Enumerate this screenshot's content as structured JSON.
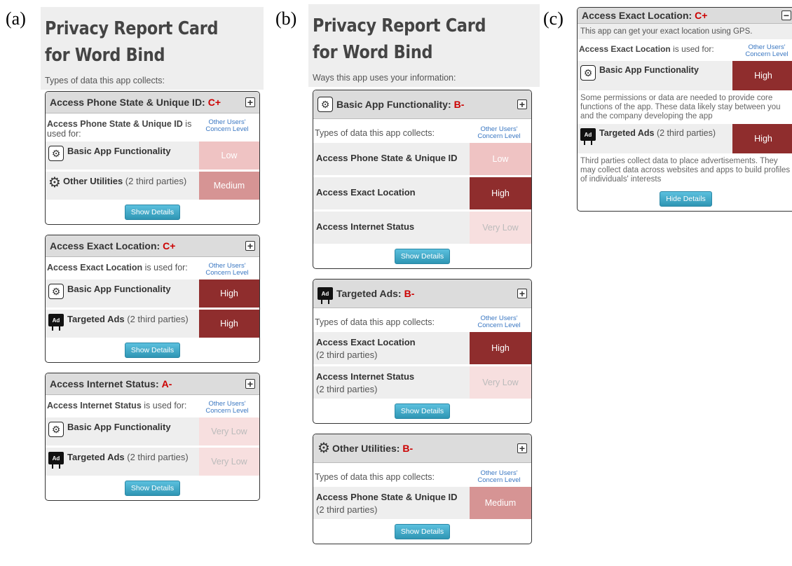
{
  "figure_labels": [
    "(a)",
    "(b)",
    "(c)"
  ],
  "panel_a": {
    "title": "Privacy Report Card for Word Bind",
    "subtitle": "Types of data this app collects:",
    "cards": [
      {
        "name": "Access Phone State & Unique ID:",
        "grade": "C+",
        "toggle": "+",
        "used_bold": "Access Phone State & Unique ID",
        "used_rest": " is used for:",
        "concern": "Other Users' Concern Level",
        "rows": [
          {
            "icon": "gear-icon",
            "label": "Basic App Functionality",
            "extra": "",
            "level": "Low"
          },
          {
            "icon": "gears-icon",
            "label": "Other Utilities",
            "extra": " (2 third parties)",
            "level": "Medium"
          }
        ],
        "button": "Show Details"
      },
      {
        "name": "Access Exact Location:",
        "grade": "C+",
        "toggle": "+",
        "used_bold": "Access Exact Location",
        "used_rest": " is used for:",
        "concern": "Other Users' Concern Level",
        "rows": [
          {
            "icon": "gear-icon",
            "label": "Basic App Functionality",
            "extra": "",
            "level": "High"
          },
          {
            "icon": "ad-icon",
            "label": "Targeted Ads",
            "extra": " (2 third parties)",
            "level": "High"
          }
        ],
        "button": "Show Details"
      },
      {
        "name": "Access Internet Status:",
        "grade": "A-",
        "toggle": "+",
        "used_bold": "Access Internet Status",
        "used_rest": " is used for:",
        "concern": "Other Users' Concern Level",
        "rows": [
          {
            "icon": "gear-icon",
            "label": "Basic App Functionality",
            "extra": "",
            "level": "Very Low"
          },
          {
            "icon": "ad-icon",
            "label": "Targeted Ads",
            "extra": " (2 third parties)",
            "level": "Very Low"
          }
        ],
        "button": "Show Details"
      }
    ]
  },
  "panel_b": {
    "title": "Privacy Report Card for Word Bind",
    "subtitle": "Ways this app uses your information:",
    "cards": [
      {
        "icon": "gear-icon",
        "name": "Basic App Functionality:",
        "grade": "B-",
        "toggle": "+",
        "types_label": "Types of data this app collects:",
        "concern": "Other Users' Concern Level",
        "rows": [
          {
            "label": "Access Phone State & Unique ID",
            "extra": "",
            "level": "Low"
          },
          {
            "label": "Access Exact Location",
            "extra": "",
            "level": "High"
          },
          {
            "label": "Access Internet Status",
            "extra": "",
            "level": "Very Low"
          }
        ],
        "button": "Show Details"
      },
      {
        "icon": "ad-icon",
        "name": "Targeted Ads:",
        "grade": "B-",
        "toggle": "+",
        "types_label": "Types of data this app collects:",
        "concern": "Other Users' Concern Level",
        "rows": [
          {
            "label": "Access Exact Location",
            "extra": "(2 third parties)",
            "level": "High"
          },
          {
            "label": "Access Internet Status",
            "extra": "(2 third parties)",
            "level": "Very Low"
          }
        ],
        "button": "Show Details"
      },
      {
        "icon": "gears-icon",
        "name": "Other Utilities:",
        "grade": "B-",
        "toggle": "+",
        "types_label": "Types of data this app collects:",
        "concern": "Other Users' Concern Level",
        "rows": [
          {
            "label": "Access Phone State & Unique ID",
            "extra": "(2 third parties)",
            "level": "Medium"
          }
        ],
        "button": "Show Details"
      }
    ]
  },
  "panel_c": {
    "name": "Access Exact Location:",
    "grade": "C+",
    "toggle": "−",
    "intro": "This app can get your exact location using GPS.",
    "used_bold": "Access Exact Location",
    "used_rest": " is used for:",
    "concern": "Other Users' Concern Level",
    "rows": [
      {
        "icon": "gear-icon",
        "label": "Basic App Functionality",
        "extra": "",
        "level": "High",
        "desc": "Some permissions or data are needed to provide core functions of the app. These data likely stay between you and the company developing the app"
      },
      {
        "icon": "ad-icon",
        "label": "Targeted Ads",
        "extra": " (2 third parties)",
        "level": "High",
        "desc": "Third parties collect data to place advertisements. They may collect data across websites and apps to build profiles of individuals' interests"
      }
    ],
    "button": "Hide Details"
  },
  "colors": {
    "grade": "#cc0000",
    "very_low": "#f7dfdf",
    "low": "#efc3c3",
    "medium": "#d69494",
    "high": "#8f2d2d",
    "concern_link": "#3a77c2",
    "button": "#2f96b4"
  }
}
